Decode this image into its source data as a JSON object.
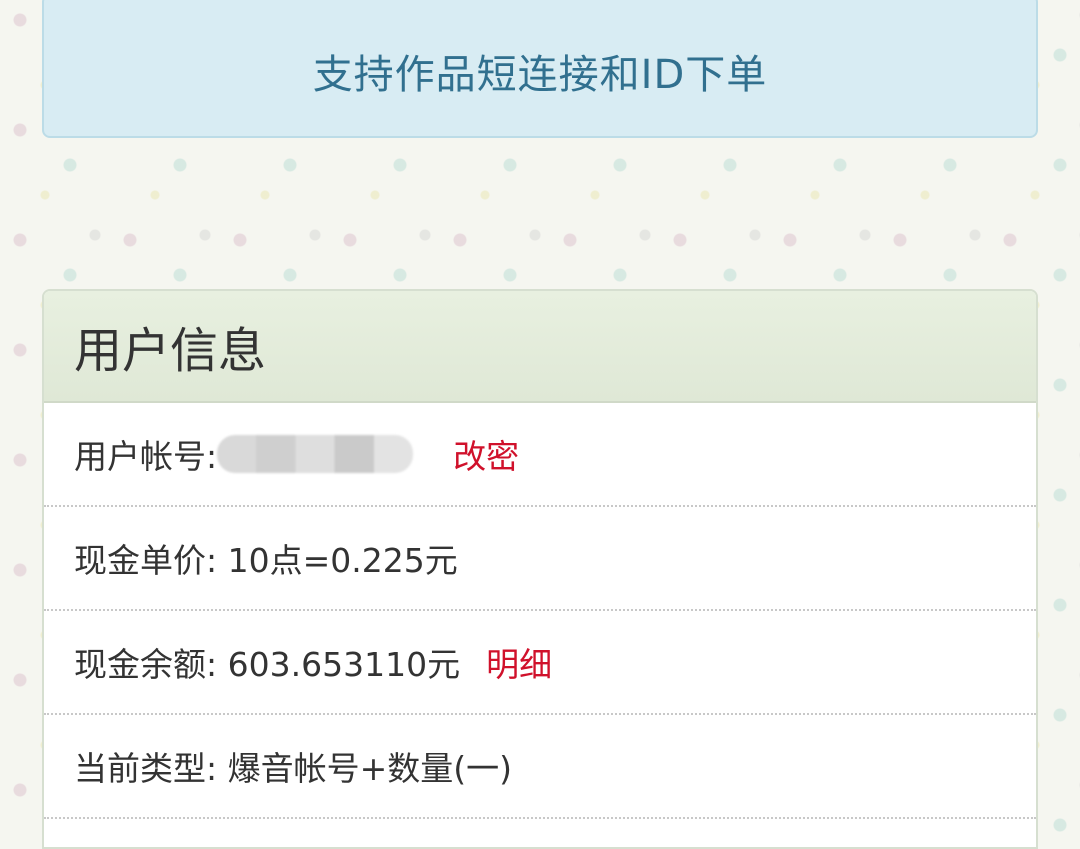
{
  "notice": {
    "text": "支持作品短连接和ID下单"
  },
  "user_info": {
    "title": "用户信息",
    "account": {
      "label": "用户帐号:",
      "action": "改密"
    },
    "unit_price": {
      "label": "现金单价:",
      "value": " 10点=0.225元"
    },
    "balance": {
      "label": "现金余额:",
      "value": " 603.653110元",
      "action": "明细"
    },
    "current_type": {
      "label": "当前类型:",
      "value": " 爆音帐号+数量(一)"
    }
  },
  "colors": {
    "notice_bg": "#d8ecf3",
    "notice_text": "#31708f",
    "link": "#d0112b",
    "heading_bg": "#e3ecdb"
  }
}
